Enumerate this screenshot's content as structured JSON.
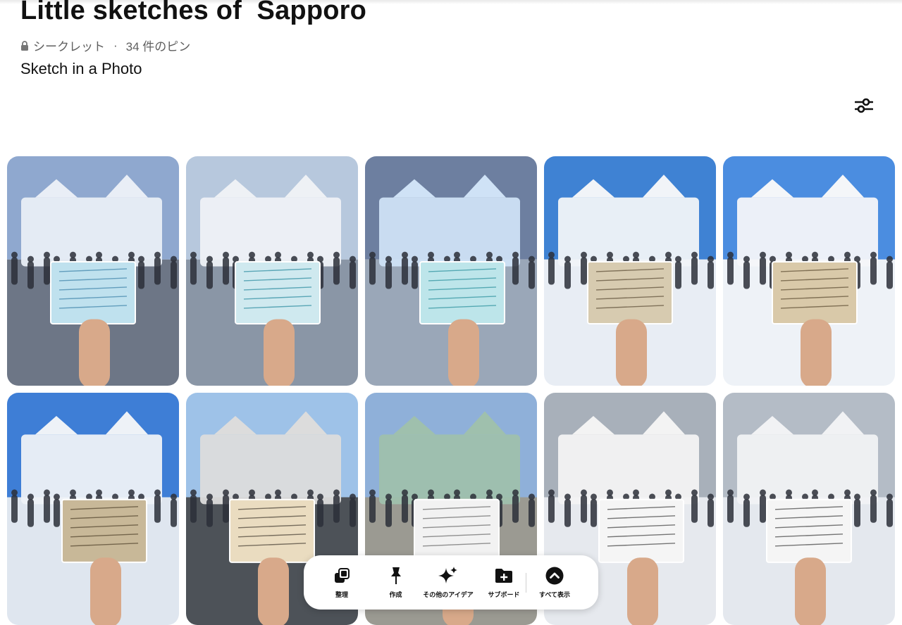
{
  "board": {
    "title": "Little sketches of  Sapporo",
    "privacy": "シークレット",
    "separator": "·",
    "pin_count": "34 件のピン",
    "description": "Sketch in a Photo"
  },
  "icons": {
    "lock": "lock-icon",
    "filter": "sliders-icon",
    "organize": "organize-icon",
    "create": "pushpin-icon",
    "ideas": "sparkle-icon",
    "section": "add-folder-icon",
    "show_all": "chevron-up-circle-icon"
  },
  "toolbar": {
    "organize": "整理",
    "create": "作成",
    "more_ideas": "その他のアイデア",
    "subboard": "サブボード",
    "show_all": "すべて表示"
  },
  "pins": [
    {
      "sky": "#8fa8cf",
      "ground": "#6d7686",
      "sculpture": "#e9eef6",
      "card": "#bfe1ee",
      "card_line": "#4b8db0",
      "alt": "Sketch held in front of snow sculpture"
    },
    {
      "sky": "#b7c8dd",
      "ground": "#8a96a6",
      "sculpture": "#eef1f5",
      "card": "#cfe9ef",
      "card_line": "#3e96a8",
      "alt": "Sketch held in front of snow sculpture"
    },
    {
      "sky": "#6d7fa0",
      "ground": "#9aa7b8",
      "sculpture": "#cfe2f6",
      "card": "#bde5ea",
      "card_line": "#3b9aa5",
      "alt": "Sketch held in front of illuminated sculpture"
    },
    {
      "sky": "#3f82d3",
      "ground": "#e8edf4",
      "sculpture": "#f1f4f8",
      "card": "#d7cbb0",
      "card_line": "#6a5b44",
      "alt": "Sketch held in front of snow building"
    },
    {
      "sky": "#4b8de0",
      "ground": "#eef2f7",
      "sculpture": "#f4f6f9",
      "card": "#d9c9a9",
      "card_line": "#6b5a40",
      "alt": "Sketch held in front of snow castle"
    },
    {
      "sky": "#3e7ed6",
      "ground": "#dfe6ef",
      "sculpture": "#eef2f7",
      "card": "#c8b898",
      "card_line": "#5e5038",
      "alt": "Sketch held in front of snow sculpture"
    },
    {
      "sky": "#9ec2e8",
      "ground": "#4d5258",
      "sculpture": "#dcdcdc",
      "card": "#eadcc0",
      "card_line": "#5b5245",
      "alt": "Sketch held under a bridge"
    },
    {
      "sky": "#8fb0d9",
      "ground": "#9b9a92",
      "sculpture": "#9fc0ad",
      "card": "#f2f2f2",
      "card_line": "#777777",
      "alt": "Sketch in front of relief monument"
    },
    {
      "sky": "#a8b0ba",
      "ground": "#e6e9ee",
      "sculpture": "#f3f3f3",
      "card": "#f5f5f5",
      "card_line": "#555555",
      "alt": "Sketchbook with paints in front of snow building"
    },
    {
      "sky": "#b4bcc6",
      "ground": "#e4e8ee",
      "sculpture": "#f1f2f4",
      "card": "#f5f5f5",
      "card_line": "#555555",
      "alt": "Sketchbook with paints in front of snow sculpture"
    }
  ]
}
